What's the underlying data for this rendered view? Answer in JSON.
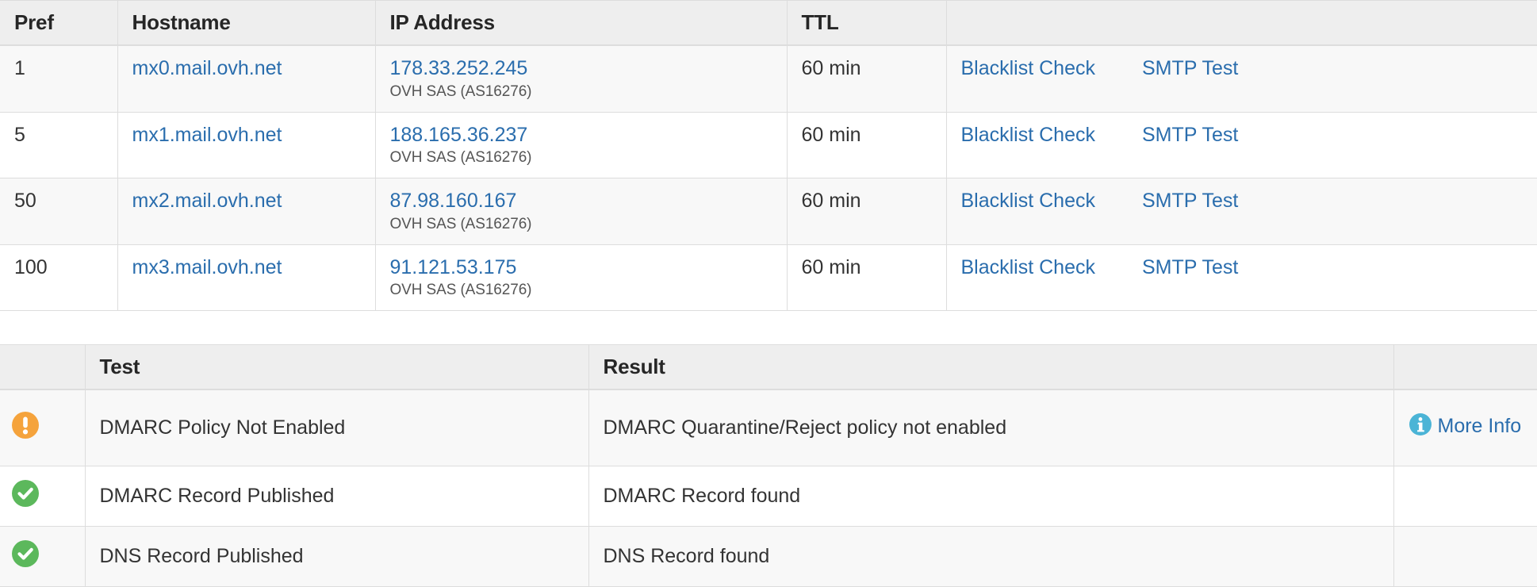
{
  "mx_table": {
    "columns": [
      "Pref",
      "Hostname",
      "IP Address",
      "TTL",
      ""
    ],
    "rows": [
      {
        "pref": "1",
        "hostname": "mx0.mail.ovh.net",
        "ip": "178.33.252.245",
        "asn": "OVH SAS (AS16276)",
        "ttl": "60 min",
        "action_blacklist": "Blacklist Check",
        "action_smtp": "SMTP Test"
      },
      {
        "pref": "5",
        "hostname": "mx1.mail.ovh.net",
        "ip": "188.165.36.237",
        "asn": "OVH SAS (AS16276)",
        "ttl": "60 min",
        "action_blacklist": "Blacklist Check",
        "action_smtp": "SMTP Test"
      },
      {
        "pref": "50",
        "hostname": "mx2.mail.ovh.net",
        "ip": "87.98.160.167",
        "asn": "OVH SAS (AS16276)",
        "ttl": "60 min",
        "action_blacklist": "Blacklist Check",
        "action_smtp": "SMTP Test"
      },
      {
        "pref": "100",
        "hostname": "mx3.mail.ovh.net",
        "ip": "91.121.53.175",
        "asn": "OVH SAS (AS16276)",
        "ttl": "60 min",
        "action_blacklist": "Blacklist Check",
        "action_smtp": "SMTP Test"
      }
    ]
  },
  "test_table": {
    "columns": [
      "",
      "Test",
      "Result",
      ""
    ],
    "rows": [
      {
        "status": "warning-icon",
        "test": "DMARC Policy Not Enabled",
        "result": "DMARC Quarantine/Reject policy not enabled",
        "more_label": "More Info"
      },
      {
        "status": "success-icon",
        "test": "DMARC Record Published",
        "result": "DMARC Record found",
        "more_label": ""
      },
      {
        "status": "success-icon",
        "test": "DNS Record Published",
        "result": "DNS Record found",
        "more_label": ""
      }
    ]
  },
  "colors": {
    "link": "#2a6dad",
    "warning": "#f5a33c",
    "success": "#5cb85c",
    "info": "#4bb4d6",
    "header_bg": "#eeeeee",
    "row_alt_bg": "#f8f8f8",
    "border": "#dddddd"
  }
}
